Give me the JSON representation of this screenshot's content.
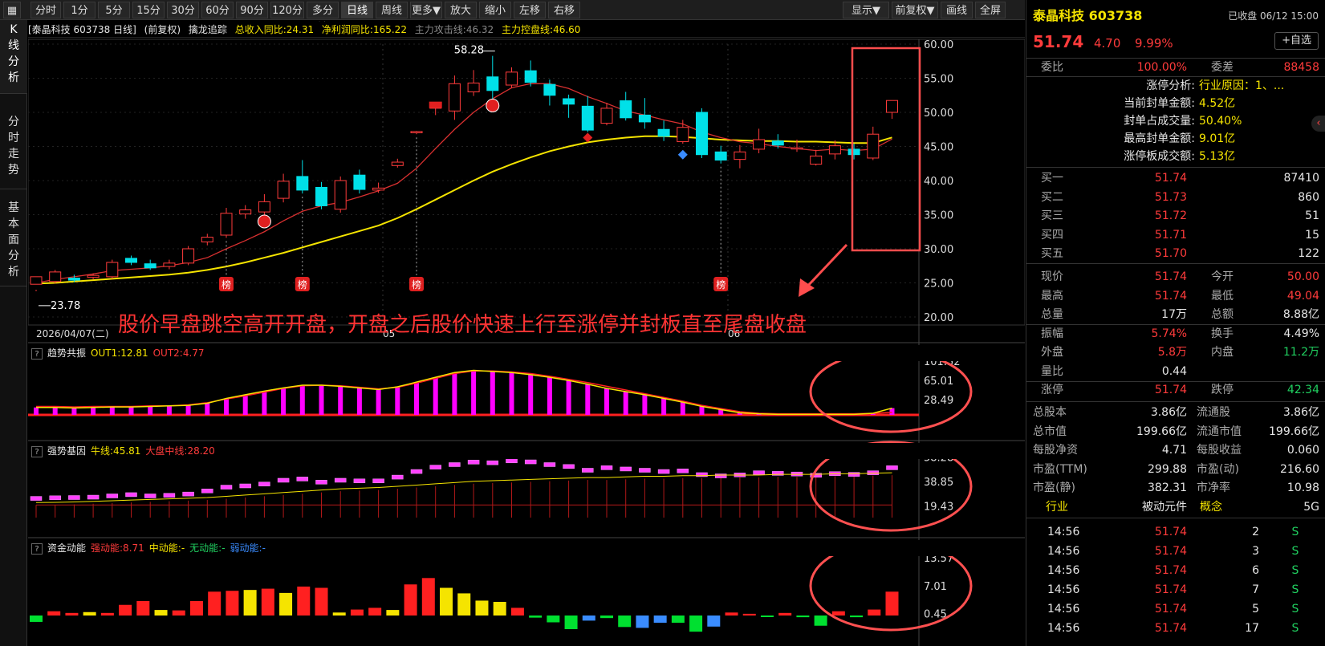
{
  "toolbar": {
    "left_items": [
      "分时",
      "1分",
      "5分",
      "15分",
      "30分",
      "60分",
      "90分",
      "120分",
      "多分钟",
      "日线",
      "周线",
      "更多▼",
      "放大",
      "缩小",
      "左移",
      "右移"
    ],
    "active": "日线",
    "right_items": [
      "显示▼",
      "前复权▼",
      "画线",
      "全屏"
    ]
  },
  "side_tabs": [
    "K线分析",
    "分时走势",
    "基本面分析"
  ],
  "main_info": {
    "stock_label": "[泰晶科技 603738 日线]",
    "adjust": "(前复权)",
    "indicator": "擒龙追踪",
    "revenue": "总收入同比:24.31",
    "profit": "净利润同比:165.22",
    "attack": "主力攻击线:46.32",
    "control": "主力控盘线:46.60"
  },
  "price_axis": [
    "60.00",
    "55.00",
    "50.00",
    "45.00",
    "40.00",
    "35.00",
    "30.00",
    "25.00",
    "20.00"
  ],
  "high_label": "58.28",
  "low_label": "23.78",
  "date_axis": {
    "start": "2026/04/07(二)",
    "m1": "05",
    "m2": "06"
  },
  "bang_label": "榜",
  "annotation": "股价早盘跳空高开开盘，开盘之后股价快速上行至涨停并封板直至尾盘收盘",
  "panel1": {
    "title": "趋势共振",
    "out1": "OUT1:12.81",
    "out2": "OUT2:4.77",
    "axis": [
      "101.52",
      "65.01",
      "28.49"
    ]
  },
  "panel2": {
    "title": "强势基因",
    "bull": "牛线:45.81",
    "market": "大盘中线:28.20",
    "axis": [
      "58.28",
      "38.85",
      "19.43"
    ]
  },
  "panel3": {
    "title": "资金动能",
    "strong": "强动能:8.71",
    "mid": "中动能:-",
    "none": "无动能:-",
    "weak": "弱动能:-",
    "axis": [
      "13.57",
      "7.01",
      "0.45"
    ]
  },
  "right": {
    "name": "泰晶科技 603738",
    "status": "已收盘 06/12 15:00",
    "price": "51.74",
    "change": "4.70",
    "pct": "9.99%",
    "add_btn": "+自选",
    "weibi_label": "委比",
    "weibi": "100.00%",
    "weicha_label": "委差",
    "weicha": "88458",
    "limit_analysis": [
      {
        "label": "涨停分析:",
        "value": "行业原因：1、..."
      },
      {
        "label": "当前封单金额:",
        "value": "4.52亿"
      },
      {
        "label": "封单占成交量:",
        "value": "50.40%"
      },
      {
        "label": "最高封单金额:",
        "value": "9.01亿"
      },
      {
        "label": "涨停板成交额:",
        "value": "5.13亿"
      }
    ],
    "bids": [
      {
        "label": "买一",
        "price": "51.74",
        "vol": "87410"
      },
      {
        "label": "买二",
        "price": "51.73",
        "vol": "860"
      },
      {
        "label": "买三",
        "price": "51.72",
        "vol": "51"
      },
      {
        "label": "买四",
        "price": "51.71",
        "vol": "15"
      },
      {
        "label": "买五",
        "price": "51.70",
        "vol": "122"
      }
    ],
    "quote": [
      {
        "l1": "现价",
        "v1": "51.74",
        "c1": "red",
        "l2": "今开",
        "v2": "50.00",
        "c2": "red"
      },
      {
        "l1": "最高",
        "v1": "51.74",
        "c1": "red",
        "l2": "最低",
        "v2": "49.04",
        "c2": "red"
      },
      {
        "l1": "总量",
        "v1": "17万",
        "c1": "white",
        "l2": "总额",
        "v2": "8.88亿",
        "c2": "white"
      },
      {
        "l1": "振幅",
        "v1": "5.74%",
        "c1": "red",
        "l2": "换手",
        "v2": "4.49%",
        "c2": "white"
      },
      {
        "l1": "外盘",
        "v1": "5.8万",
        "c1": "red",
        "l2": "内盘",
        "v2": "11.2万",
        "c2": "green"
      },
      {
        "l1": "量比",
        "v1": "0.44",
        "c1": "white",
        "l2": "",
        "v2": "",
        "c2": "white"
      },
      {
        "l1": "涨停",
        "v1": "51.74",
        "c1": "red",
        "l2": "跌停",
        "v2": "42.34",
        "c2": "green"
      }
    ],
    "fundamentals": [
      {
        "l1": "总股本",
        "v1": "3.86亿",
        "l2": "流通股",
        "v2": "3.86亿"
      },
      {
        "l1": "总市值",
        "v1": "199.66亿",
        "l2": "流通市值",
        "v2": "199.66亿"
      },
      {
        "l1": "每股净资",
        "v1": "4.71",
        "l2": "每股收益",
        "v2": "0.060"
      },
      {
        "l1": "市盈(TTM)",
        "v1": "299.88",
        "l2": "市盈(动)",
        "v2": "216.60"
      },
      {
        "l1": "市盈(静)",
        "v1": "382.31",
        "l2": "市净率",
        "v2": "10.98"
      }
    ],
    "industry": {
      "l1": "行业",
      "v1": "被动元件",
      "l2": "概念",
      "v2": "5G"
    },
    "ticks": [
      {
        "time": "14:56",
        "price": "51.74",
        "vol": "2",
        "side": "S"
      },
      {
        "time": "14:56",
        "price": "51.74",
        "vol": "3",
        "side": "S"
      },
      {
        "time": "14:56",
        "price": "51.74",
        "vol": "6",
        "side": "S"
      },
      {
        "time": "14:56",
        "price": "51.74",
        "vol": "7",
        "side": "S"
      },
      {
        "time": "14:56",
        "price": "51.74",
        "vol": "5",
        "side": "S"
      },
      {
        "time": "14:56",
        "price": "51.74",
        "vol": "17",
        "side": "S"
      }
    ]
  },
  "chart_data": [
    {
      "type": "candlestick",
      "ylim": [
        20,
        60
      ],
      "ohlc": [
        [
          24.8,
          25.9,
          24.0,
          23.78
        ],
        [
          25.2,
          26.6,
          26.9,
          24.9
        ],
        [
          25.7,
          25.4,
          26.2,
          25.1
        ],
        [
          25.8,
          26.1,
          26.4,
          25.5
        ],
        [
          25.9,
          28.0,
          28.4,
          25.6
        ],
        [
          28.6,
          28.0,
          29.0,
          27.6
        ],
        [
          27.8,
          27.2,
          28.4,
          26.9
        ],
        [
          27.4,
          27.9,
          28.4,
          27.0
        ],
        [
          27.9,
          30.0,
          30.4,
          27.6
        ],
        [
          31.0,
          31.7,
          32.2,
          30.5
        ],
        [
          32.0,
          35.2,
          36.0,
          31.6
        ],
        [
          35.1,
          35.7,
          36.4,
          34.4
        ],
        [
          35.4,
          36.9,
          38.0,
          34.6
        ],
        [
          37.4,
          39.9,
          41.0,
          36.8
        ],
        [
          40.6,
          38.6,
          43.0,
          38.1
        ],
        [
          39.0,
          36.3,
          39.8,
          35.8
        ],
        [
          35.8,
          40.0,
          40.6,
          35.3
        ],
        [
          40.8,
          38.7,
          41.6,
          38.1
        ],
        [
          38.6,
          38.9,
          39.7,
          38.2
        ],
        [
          42.2,
          42.7,
          43.2,
          41.9
        ],
        [
          47.0,
          47.2,
          47.3,
          46.8
        ],
        [
          50.6,
          51.1,
          51.3,
          49.6
        ],
        [
          50.2,
          54.2,
          55.4,
          48.9
        ],
        [
          53.0,
          54.3,
          56.2,
          52.4
        ],
        [
          55.2,
          53.2,
          58.28,
          51.8
        ],
        [
          54.0,
          55.9,
          56.6,
          53.6
        ],
        [
          56.1,
          54.4,
          57.6,
          53.8
        ],
        [
          54.1,
          52.5,
          54.8,
          51.0
        ],
        [
          52.0,
          51.2,
          52.6,
          49.2
        ],
        [
          50.9,
          47.4,
          52.4,
          47.1
        ],
        [
          48.4,
          50.6,
          51.4,
          48.1
        ],
        [
          51.7,
          49.2,
          53.0,
          48.8
        ],
        [
          49.6,
          48.6,
          52.1,
          47.6
        ],
        [
          47.5,
          46.5,
          48.8,
          45.8
        ],
        [
          45.7,
          47.8,
          48.9,
          45.4
        ],
        [
          50.0,
          43.8,
          50.6,
          43.3
        ],
        [
          44.2,
          43.0,
          45.1,
          42.5
        ],
        [
          43.1,
          44.2,
          45.2,
          41.8
        ],
        [
          44.6,
          46.0,
          47.6,
          44.0
        ],
        [
          45.8,
          45.2,
          46.8,
          44.7
        ],
        [
          44.8,
          44.8,
          46.0,
          44.2
        ],
        [
          42.4,
          43.6,
          44.5,
          42.2
        ],
        [
          43.9,
          45.1,
          45.9,
          43.1
        ],
        [
          44.6,
          43.8,
          45.4,
          43.1
        ],
        [
          43.3,
          46.8,
          47.9,
          43.0
        ],
        [
          50.0,
          51.74,
          51.74,
          49.04
        ]
      ],
      "ma_short": [
        25.0,
        25.5,
        25.9,
        26.3,
        26.8,
        27.0,
        27.2,
        27.5,
        28.0,
        28.7,
        30.0,
        31.2,
        32.5,
        34.1,
        35.5,
        36.3,
        36.8,
        37.6,
        38.5,
        39.6,
        41.8,
        44.7,
        47.5,
        50.0,
        52.0,
        53.6,
        54.2,
        54.2,
        53.5,
        52.3,
        51.3,
        50.2,
        49.6,
        48.9,
        48.3,
        47.1,
        46.3,
        45.7,
        45.4,
        45.0,
        44.7,
        44.4,
        44.6,
        44.4,
        44.6,
        46.1
      ],
      "ma_long": [
        24.9,
        25.0,
        25.2,
        25.4,
        25.6,
        25.8,
        26.0,
        26.2,
        26.5,
        26.9,
        27.4,
        28.0,
        28.7,
        29.4,
        30.2,
        31.0,
        31.8,
        32.6,
        33.4,
        34.5,
        35.8,
        37.2,
        38.6,
        40.0,
        41.3,
        42.4,
        43.4,
        44.3,
        45.0,
        45.6,
        46.0,
        46.3,
        46.5,
        46.5,
        46.4,
        46.2,
        46.0,
        45.9,
        45.8,
        45.8,
        45.7,
        45.7,
        45.6,
        45.5,
        45.5,
        46.32
      ],
      "high_value": 58.28,
      "low_value": 23.78
    },
    {
      "type": "bar",
      "name": "趋势共振",
      "ylim": [
        0,
        101.52
      ],
      "values": [
        14,
        14,
        13,
        14,
        15,
        15,
        16,
        17,
        18,
        22,
        31,
        38,
        45,
        51,
        56,
        56,
        54,
        51,
        48,
        53,
        62,
        71,
        80,
        84,
        82,
        80,
        76,
        71,
        65,
        58,
        50,
        44,
        38,
        31,
        24,
        16,
        10,
        4,
        2,
        1,
        1,
        1,
        1,
        1,
        3,
        12.81
      ],
      "out1": [
        14,
        14,
        13,
        14,
        15,
        15,
        16,
        17,
        18,
        22,
        31,
        38,
        45,
        51,
        56,
        56,
        54,
        51,
        48,
        53,
        62,
        71,
        80,
        84,
        82,
        80,
        76,
        71,
        65,
        58,
        50,
        44,
        38,
        31,
        24,
        16,
        10,
        4,
        2,
        1,
        1,
        1,
        1,
        1,
        3,
        12.81
      ],
      "out2": [
        16,
        16,
        15,
        16,
        16,
        16,
        17,
        17,
        19,
        23,
        30,
        36,
        43,
        50,
        55,
        56,
        55,
        52,
        49,
        52,
        60,
        69,
        78,
        83,
        83,
        81,
        78,
        73,
        67,
        61,
        54,
        47,
        40,
        33,
        26,
        18,
        12,
        6,
        3,
        2,
        2,
        2,
        2,
        2,
        3,
        4.77
      ]
    },
    {
      "type": "bar",
      "name": "强势基因",
      "ylim": [
        10,
        60
      ],
      "values": [
        25,
        25.5,
        25.7,
        26,
        27,
        28,
        27,
        27.5,
        28.5,
        31,
        34,
        35,
        36.5,
        39.5,
        40.5,
        38,
        39.5,
        39,
        39,
        42,
        46.5,
        50,
        52,
        54,
        53.5,
        55,
        54.2,
        52,
        50.5,
        47.5,
        49.5,
        48.5,
        47.5,
        46.5,
        47,
        44,
        43,
        43.8,
        45.5,
        45,
        44.5,
        43.5,
        44.8,
        44.2,
        45.5,
        49.5
      ],
      "bull_line": [
        22,
        22.2,
        22.5,
        23,
        23.5,
        24,
        24.5,
        25,
        25.5,
        26,
        27,
        28,
        29,
        30,
        31,
        32,
        33,
        33.5,
        34,
        35,
        36,
        37,
        38,
        39,
        39.5,
        40,
        40.5,
        41,
        41.5,
        42,
        42,
        42.5,
        43,
        43,
        43.5,
        43.5,
        44,
        44,
        44,
        44.5,
        44.5,
        44.5,
        45,
        45,
        45.5,
        45.81
      ]
    },
    {
      "type": "bar",
      "name": "资金动能",
      "ylim": [
        -4,
        13.57
      ],
      "values": [
        -1.5,
        1.0,
        0.6,
        0.8,
        0.6,
        2.5,
        3.4,
        1.3,
        1.2,
        3.4,
        5.6,
        5.8,
        6.0,
        6.3,
        5.3,
        6.8,
        6.5,
        0.7,
        1.4,
        1.8,
        1.3,
        7.3,
        8.8,
        6.5,
        5.2,
        3.5,
        3.2,
        1.8,
        -0.5,
        -1.6,
        -3.2,
        -1.2,
        -0.6,
        -2.7,
        -2.9,
        -1.7,
        -1.7,
        -3.8,
        -2.6,
        0.7,
        0.4,
        -0.3,
        0.6,
        -0.4,
        -2.4,
        1.0,
        -0.4,
        1.4,
        5.6
      ]
    }
  ]
}
